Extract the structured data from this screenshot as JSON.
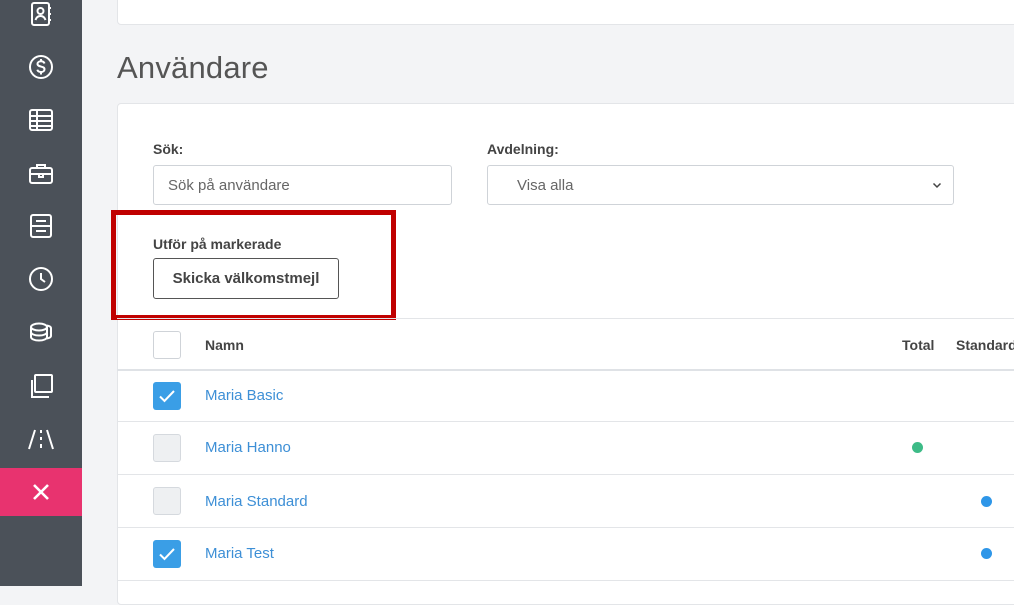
{
  "sidebar": {
    "items": [
      {
        "icon": "contact-book-icon"
      },
      {
        "icon": "dollar-icon"
      },
      {
        "icon": "table-icon"
      },
      {
        "icon": "briefcase-icon"
      },
      {
        "icon": "document-icon"
      },
      {
        "icon": "clock-icon"
      },
      {
        "icon": "coins-icon"
      },
      {
        "icon": "copy-icon"
      },
      {
        "icon": "road-icon"
      },
      {
        "icon": "close-icon"
      }
    ],
    "active_color": "#e8336f"
  },
  "page": {
    "title": "Användare"
  },
  "filters": {
    "search_label": "Sök:",
    "search_placeholder": "Sök på användare",
    "department_label": "Avdelning:",
    "department_value": "Visa alla"
  },
  "bulk": {
    "label": "Utför på markerade",
    "button_label": "Skicka välkomstmejl"
  },
  "table": {
    "columns": {
      "name": "Namn",
      "total": "Total",
      "standard": "Standard"
    },
    "rows": [
      {
        "name": "Maria Basic",
        "checked": true,
        "total_dot": false,
        "standard_dot": false
      },
      {
        "name": "Maria Hanno",
        "checked": false,
        "total_dot": true,
        "standard_dot": false
      },
      {
        "name": "Maria Standard",
        "checked": false,
        "total_dot": false,
        "standard_dot": true
      },
      {
        "name": "Maria Test",
        "checked": true,
        "total_dot": false,
        "standard_dot": true
      }
    ]
  },
  "colors": {
    "accent": "#3a9ee6",
    "link": "#3d8fd6",
    "dot_green": "#3dbb87",
    "dot_blue": "#2e96e8",
    "highlight": "#c00000"
  }
}
